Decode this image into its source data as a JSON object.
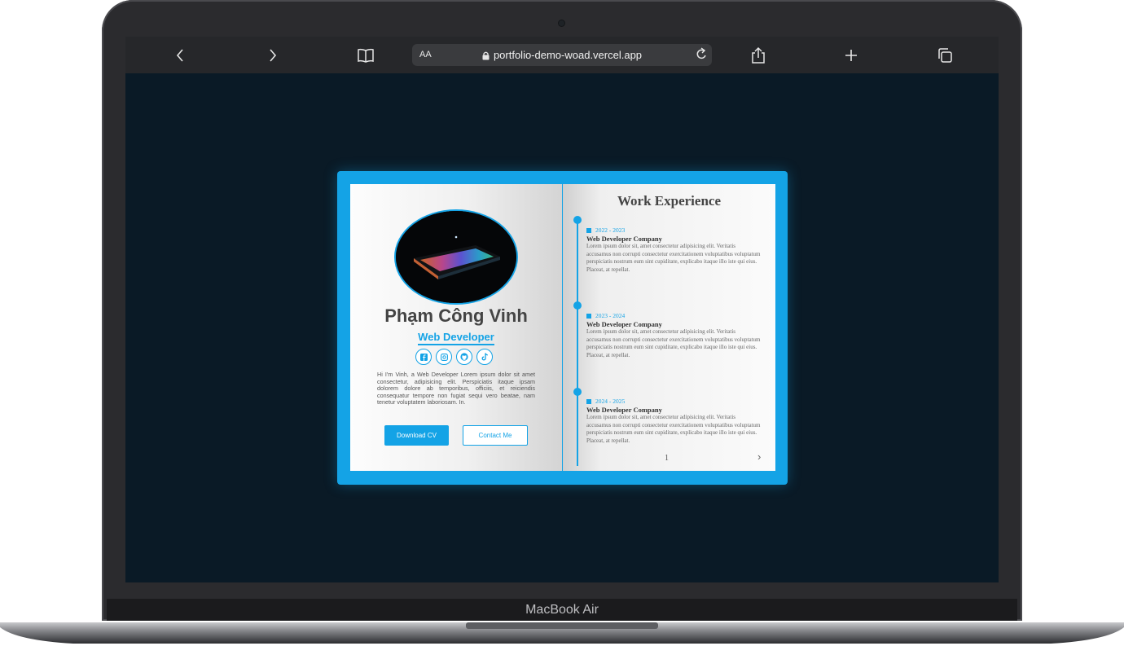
{
  "browser": {
    "url": "portfolio-demo-woad.vercel.app",
    "text_size_label": "AA"
  },
  "device": {
    "brand": "MacBook Air"
  },
  "portfolio": {
    "name": "Phạm Công Vinh",
    "role": "Web Developer",
    "bio": "Hi I'm Vinh, a Web Developer Lorem ipsum dolor sit amet consectetur, adipisicing elit. Perspiciatis itaque ipsam dolorem dolore ab temporibus, officiis, et reiciendis consequatur tempore non fugiat sequi vero beatae, nam tenetur voluptatem laboriosam. In.",
    "buttons": {
      "download_cv": "Download CV",
      "contact_me": "Contact Me"
    },
    "social_icons": [
      "facebook-icon",
      "instagram-icon",
      "github-icon",
      "tiktok-icon"
    ]
  },
  "work_experience": {
    "title": "Work Experience",
    "jobs": [
      {
        "period": "2022 - 2023",
        "company": "Web Developer Company",
        "description": "Lorem ipsum dolor sit, amet consectetur adipisicing elit. Veritatis accusamus non corrupti consectetur exercitationem voluptatibus voluptatum perspiciatis nostrum eum sint cupiditate, explicabo itaque illo iste qui eius. Placeat, at repellat."
      },
      {
        "period": "2023 - 2024",
        "company": "Web Developer Company",
        "description": "Lorem ipsum dolor sit, amet consectetur adipisicing elit. Veritatis accusamus non corrupti consectetur exercitationem voluptatibus voluptatum perspiciatis nostrum eum sint cupiditate, explicabo itaque illo iste qui eius. Placeat, at repellat."
      },
      {
        "period": "2024 - 2025",
        "company": "Web Developer Company",
        "description": "Lorem ipsum dolor sit, amet consectetur adipisicing elit. Veritatis accusamus non corrupti consectetur exercitationem voluptatibus voluptatum perspiciatis nostrum eum sint cupiditate, explicabo itaque illo iste qui eius. Placeat, at repellat."
      }
    ],
    "page_number": "1",
    "next_arrow": "›"
  },
  "colors": {
    "accent": "#14a3e6",
    "screen_background": "#0a1a26",
    "toolbar": "#26272a"
  }
}
